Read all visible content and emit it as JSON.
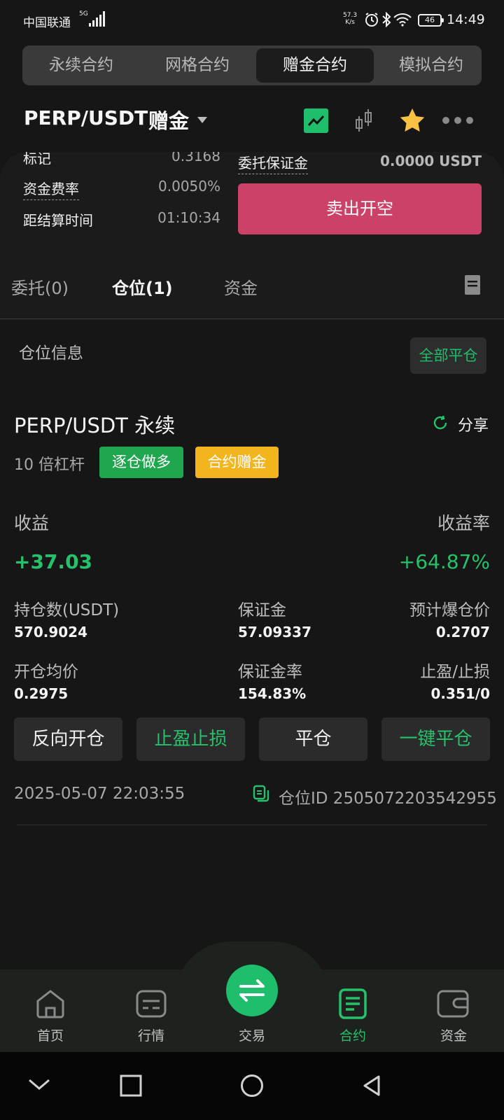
{
  "status_bar": {
    "carrier": "中国联通",
    "network": "5G",
    "speed_value": "57.3",
    "speed_unit": "K/s",
    "battery": "46",
    "time": "14:49"
  },
  "top_tabs": [
    "永续合约",
    "网格合约",
    "赠金合约",
    "模拟合约"
  ],
  "top_tabs_active_index": 2,
  "header": {
    "symbol": "PERP/USDT",
    "mode": "赠金"
  },
  "info": {
    "mark_label": "标记",
    "mark_value": "0.3168",
    "funding_label": "资金费率",
    "funding_value": "0.0050%",
    "settle_label": "距结算时间",
    "settle_value": "01:10:34",
    "entrust_margin_label": "委托保证金",
    "entrust_margin_value": "0.0000 USDT",
    "sell_button": "卖出开空"
  },
  "tabs": {
    "orders": "委托(0)",
    "positions": "仓位(1)",
    "funds": "资金"
  },
  "section": {
    "title": "仓位信息",
    "close_all": "全部平仓"
  },
  "position": {
    "pair": "PERP/USDT 永续",
    "share": "分享",
    "leverage": "10 倍杠杆",
    "badge_side": "逐仓做多",
    "badge_type": "合约赠金",
    "pnl_label": "收益",
    "pnl_value": "+37.03",
    "roe_label": "收益率",
    "roe_value": "+64.87%",
    "size_label": "持仓数(USDT)",
    "size_value": "570.9024",
    "margin_label": "保证金",
    "margin_value": "57.09337",
    "liq_label": "预计爆仓价",
    "liq_value": "0.2707",
    "entry_label": "开仓均价",
    "entry_value": "0.2975",
    "margin_ratio_label": "保证金率",
    "margin_ratio_value": "154.83%",
    "tpsl_label": "止盈/止损",
    "tpsl_value": "0.351/0",
    "btn_reverse": "反向开仓",
    "btn_tpsl": "止盈止损",
    "btn_close": "平仓",
    "btn_quick_close": "一键平仓",
    "time": "2025-05-07 22:03:55",
    "position_id": "仓位ID 2505072203542955"
  },
  "bottom_nav": [
    {
      "label": "首页",
      "icon": "home-icon"
    },
    {
      "label": "行情",
      "icon": "market-icon"
    },
    {
      "label": "交易",
      "icon": "swap-icon"
    },
    {
      "label": "合约",
      "icon": "contract-icon"
    },
    {
      "label": "资金",
      "icon": "wallet-icon"
    }
  ],
  "bottom_nav_active_index": 3,
  "colors": {
    "green": "#25c26b",
    "sell": "#cc4167",
    "bonus": "#f3b51d",
    "long": "#1fa750"
  }
}
